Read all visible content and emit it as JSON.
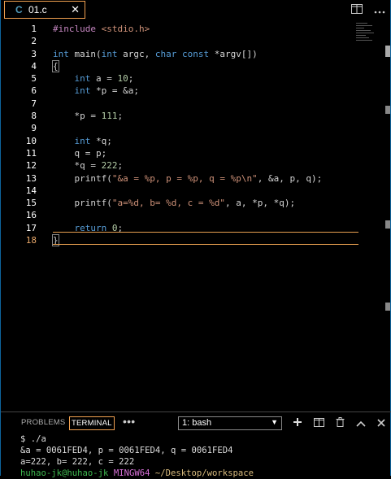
{
  "tab": {
    "icon": "C",
    "label": "01.c",
    "close": "✕"
  },
  "editor": {
    "line_numbers": [
      "1",
      "2",
      "3",
      "4",
      "5",
      "6",
      "7",
      "8",
      "9",
      "10",
      "11",
      "12",
      "13",
      "14",
      "15",
      "16",
      "17",
      "18"
    ],
    "current_line": "18",
    "lines": [
      "#include <stdio.h>",
      "",
      "int main(int argc, char const *argv[])",
      "{",
      "    int a = 10;",
      "    int *p = &a;",
      "",
      "    *p = 111;",
      "",
      "    int *q;",
      "    q = p;",
      "    *q = 222;",
      "    printf(\"&a = %p, p = %p, q = %p\\n\", &a, p, q);",
      "",
      "    printf(\"a=%d, b= %d, c = %d\", a, *p, *q);",
      "",
      "    return 0;",
      "}"
    ]
  },
  "panel": {
    "tabs": {
      "problems": "PROBLEMS",
      "terminal": "TERMINAL",
      "more": "•••"
    },
    "terminal_select": "1: bash",
    "terminal_lines": {
      "cmd": "$ ./a",
      "out1": "&a = 0061FED4, p = 0061FED4, q = 0061FED4",
      "out2": "a=222, b= 222, c = 222",
      "prompt_user": "huhao-jk@huhao-jk",
      "prompt_env": "MINGW64",
      "prompt_path": "~/Desktop/workspace"
    }
  },
  "colors": {
    "accent_border": "#f0a050",
    "keyword": "#569cd6",
    "string": "#ce9178"
  }
}
